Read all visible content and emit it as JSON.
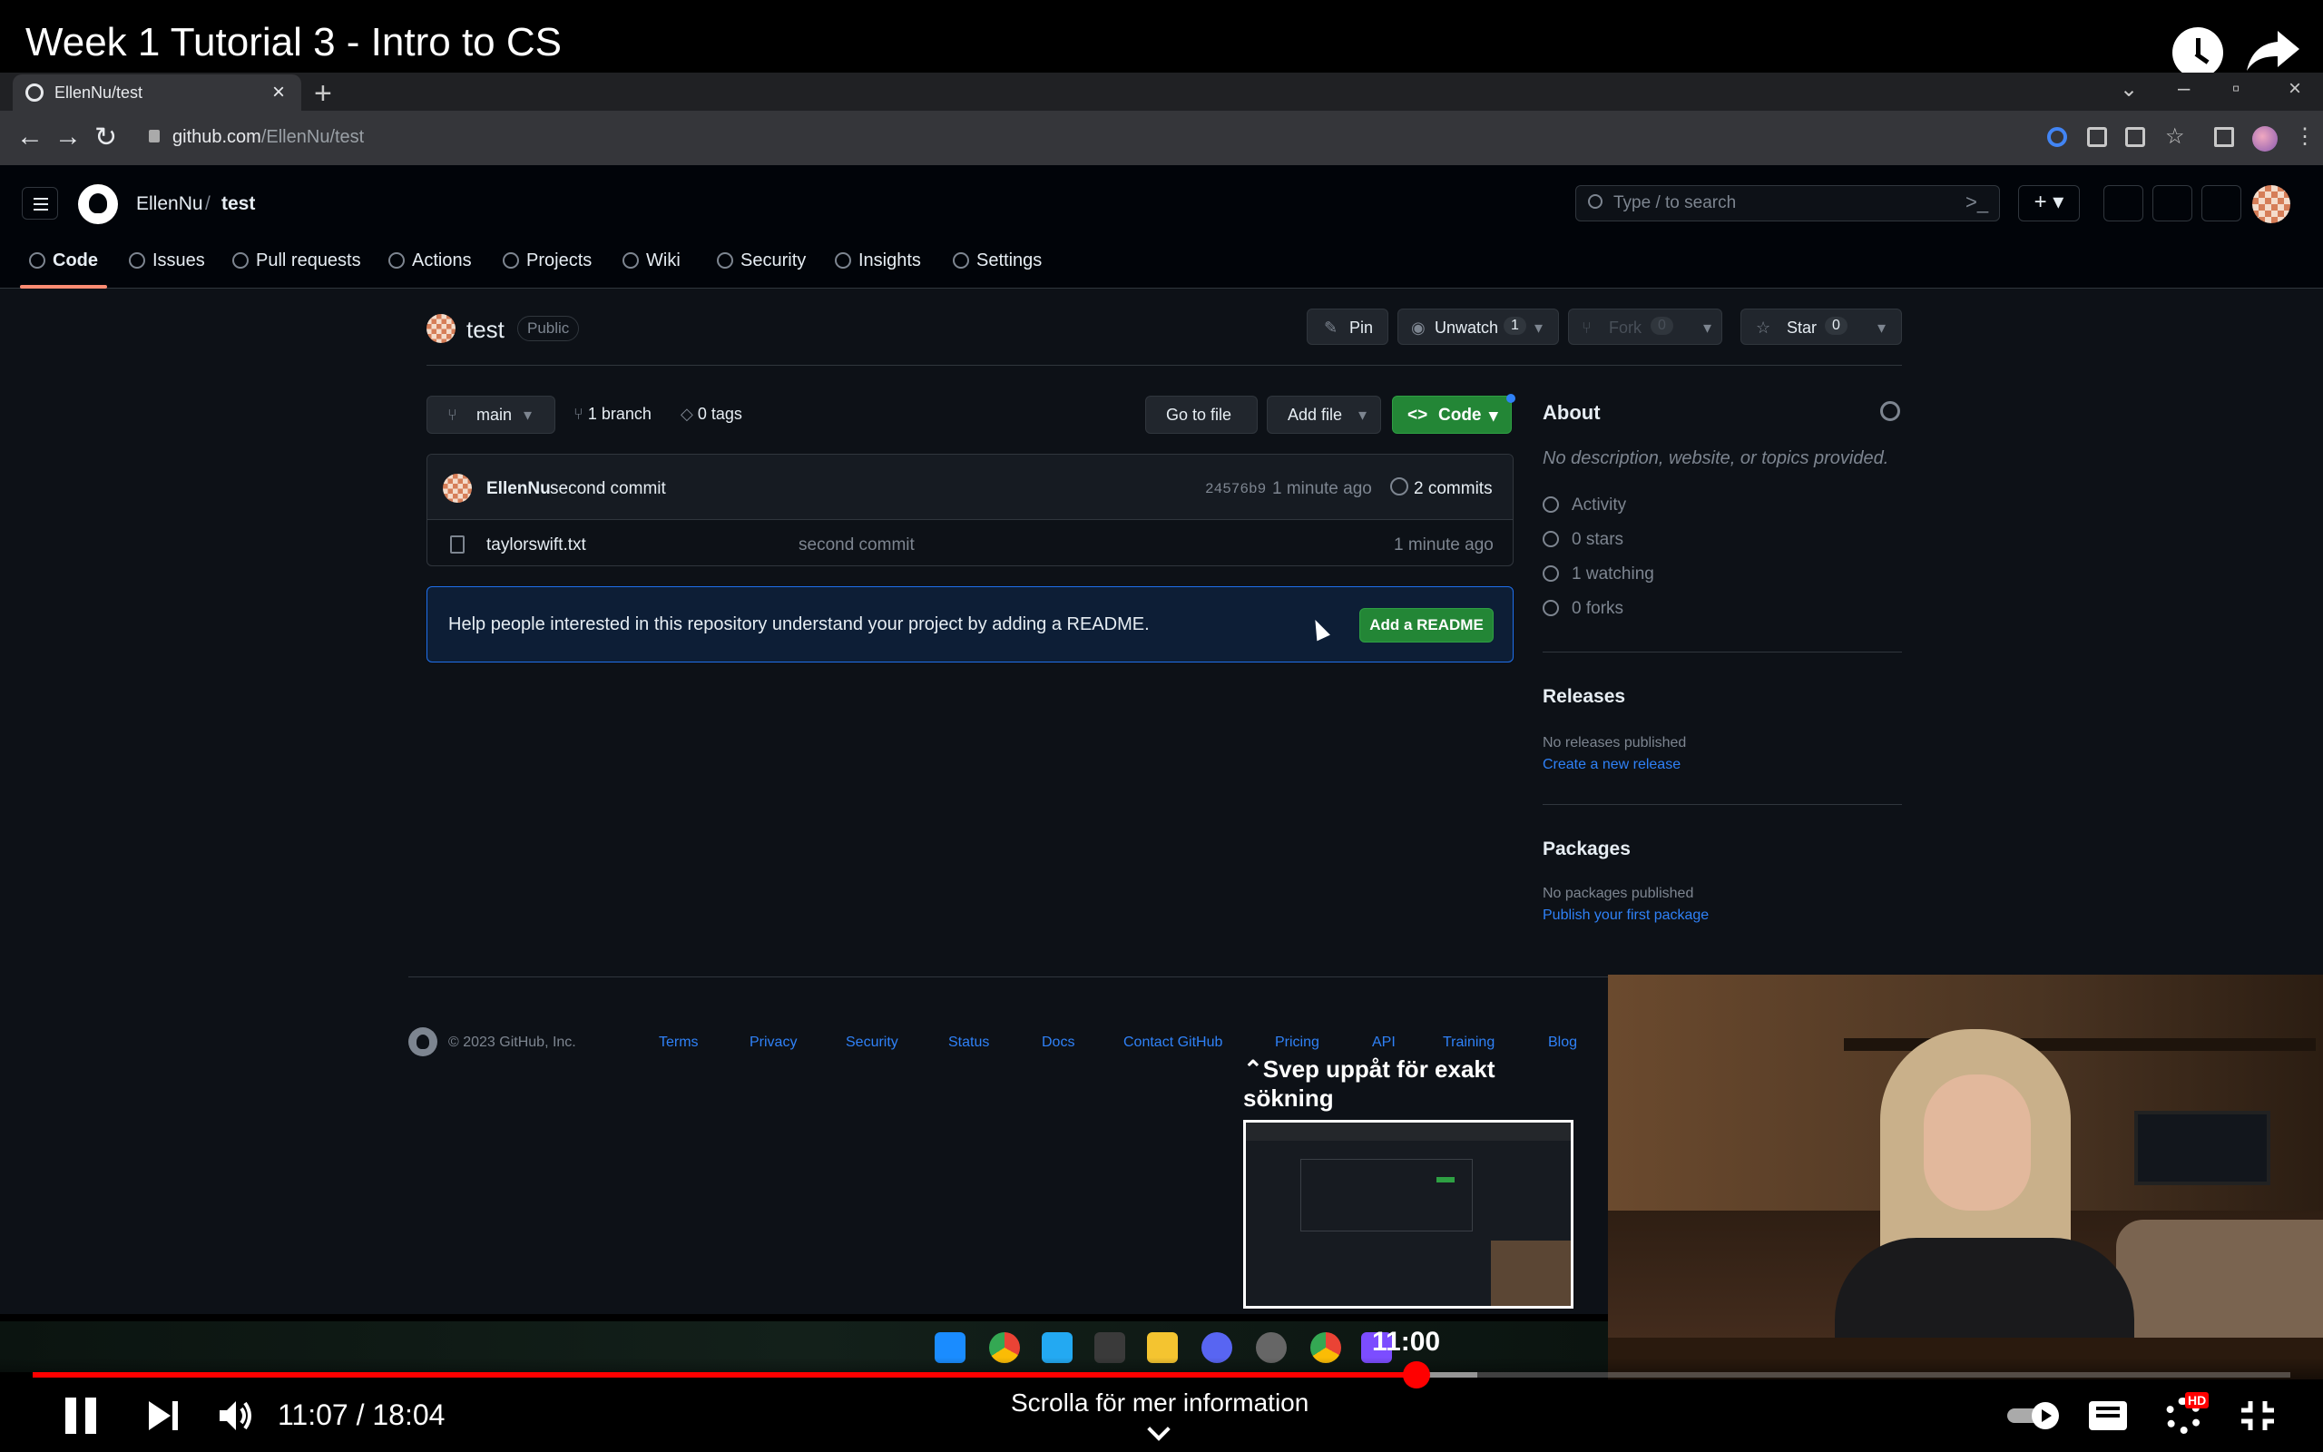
{
  "video": {
    "title": "Week 1 Tutorial 3 - Intro to CS",
    "current_time": "11:07 / 18:04",
    "progress_fraction": 0.613,
    "buffered_fraction": 0.64,
    "seek_hint": "Svep uppåt för exakt sökning",
    "seek_time": "11:00",
    "scroll_hint": "Scrolla för mer information",
    "hd_badge": "HD"
  },
  "browser": {
    "tab_title": "EllenNu/test",
    "url_host": "github.com",
    "url_path": "/EllenNu/test"
  },
  "github": {
    "owner": "EllenNu",
    "separator": "/",
    "repo": "test",
    "search_placeholder": "Type / to search",
    "repo_tabs": [
      "Code",
      "Issues",
      "Pull requests",
      "Actions",
      "Projects",
      "Wiki",
      "Security",
      "Insights",
      "Settings"
    ],
    "visibility": "Public",
    "pin_label": "Pin",
    "unwatch_label": "Unwatch",
    "unwatch_count": "1",
    "fork_label": "Fork",
    "fork_count": "0",
    "star_label": "Star",
    "star_count": "0",
    "branch_label": "main",
    "branch_count": "1 branch",
    "tags_count": "0 tags",
    "goto_file": "Go to file",
    "add_file": "Add file",
    "code_button": "Code",
    "commit": {
      "author": "EllenNu",
      "message": "second commit",
      "sha": "24576b9",
      "time": "1 minute ago",
      "count": "2 commits"
    },
    "files": [
      {
        "name": "taylorswift.txt",
        "message": "second commit",
        "time": "1 minute ago"
      }
    ],
    "readme_prompt": "Help people interested in this repository understand your project by adding a README.",
    "readme_button": "Add a README",
    "about": {
      "heading": "About",
      "description": "No description, website, or topics provided.",
      "activity": "Activity",
      "stars": "0 stars",
      "watching": "1 watching",
      "forks": "0 forks"
    },
    "releases": {
      "heading": "Releases",
      "empty": "No releases published",
      "link": "Create a new release"
    },
    "packages": {
      "heading": "Packages",
      "empty": "No packages published",
      "link": "Publish your first package"
    },
    "footer": {
      "copyright": "© 2023 GitHub, Inc.",
      "links": [
        "Terms",
        "Privacy",
        "Security",
        "Status",
        "Docs",
        "Contact GitHub",
        "Pricing",
        "API",
        "Training",
        "Blog"
      ]
    }
  },
  "colors": {
    "gh_bg": "#0d1117",
    "gh_header": "#010409",
    "accent_green": "#238636",
    "link_blue": "#2f81f7",
    "progress_red": "#ff0000"
  }
}
